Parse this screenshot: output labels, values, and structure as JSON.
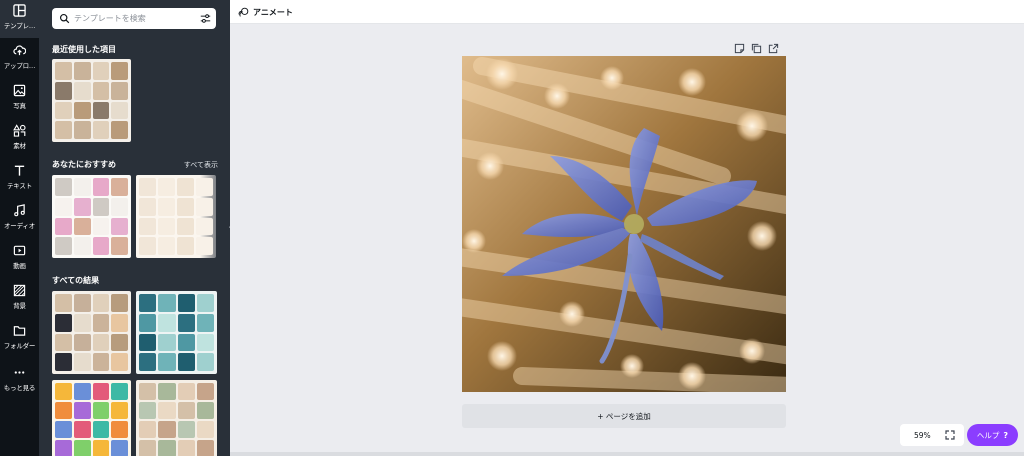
{
  "rail": {
    "items": [
      {
        "label": "テンプレ…",
        "icon": "template-icon"
      },
      {
        "label": "アップロ…",
        "icon": "cloud-upload-icon"
      },
      {
        "label": "写真",
        "icon": "photo-icon"
      },
      {
        "label": "素材",
        "icon": "elements-icon"
      },
      {
        "label": "テキスト",
        "icon": "text-icon"
      },
      {
        "label": "オーディオ",
        "icon": "music-note-icon"
      },
      {
        "label": "動画",
        "icon": "video-icon"
      },
      {
        "label": "背景",
        "icon": "background-icon"
      },
      {
        "label": "フォルダー",
        "icon": "folder-icon"
      },
      {
        "label": "もっと見る",
        "icon": "more-dots-icon"
      }
    ]
  },
  "panel": {
    "search_placeholder": "テンプレートを検索",
    "recent_title": "最近使用した項目",
    "recommend_title": "あなたにおすすめ",
    "see_all": "すべて表示",
    "results_title": "すべての結果"
  },
  "topbar": {
    "animate_label": "アニメート"
  },
  "canvas": {
    "add_page_label": "+ ページを追加"
  },
  "footer": {
    "zoom": "59%",
    "help_label": "ヘルプ",
    "help_mark": "?"
  },
  "colors": {
    "accent": "#8b3dff",
    "rail_bg": "#0e1318",
    "panel_bg": "#293039",
    "workspace_bg": "#ebecf0"
  }
}
